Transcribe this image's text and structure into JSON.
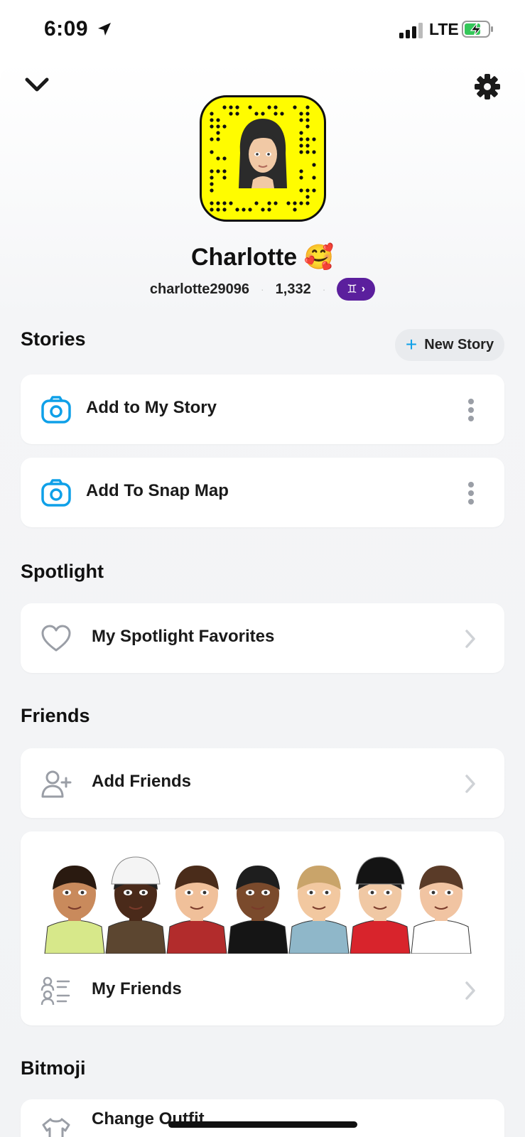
{
  "status": {
    "time": "6:09",
    "network": "LTE"
  },
  "profile": {
    "display_name": "Charlotte",
    "emoji": "🥰",
    "username": "charlotte29096",
    "score": "1,332",
    "zodiac_symbol": "♊",
    "zodiac_chevron": "›"
  },
  "stories": {
    "title": "Stories",
    "new_story_plus": "+",
    "new_story_label": "New Story",
    "items": [
      {
        "label": "Add to My Story"
      },
      {
        "label": "Add To Snap Map"
      }
    ]
  },
  "spotlight": {
    "title": "Spotlight",
    "favorites_label": "My Spotlight Favorites"
  },
  "friends": {
    "title": "Friends",
    "add_label": "Add Friends",
    "my_friends_label": "My Friends"
  },
  "bitmoji": {
    "title": "Bitmoji",
    "change_outfit_label": "Change Outfit"
  },
  "colors": {
    "snap_yellow": "#FFFC00",
    "zodiac_purple": "#5b1f9d",
    "accent_blue": "#0fa0e8",
    "icon_gray": "#9a9ea6"
  }
}
